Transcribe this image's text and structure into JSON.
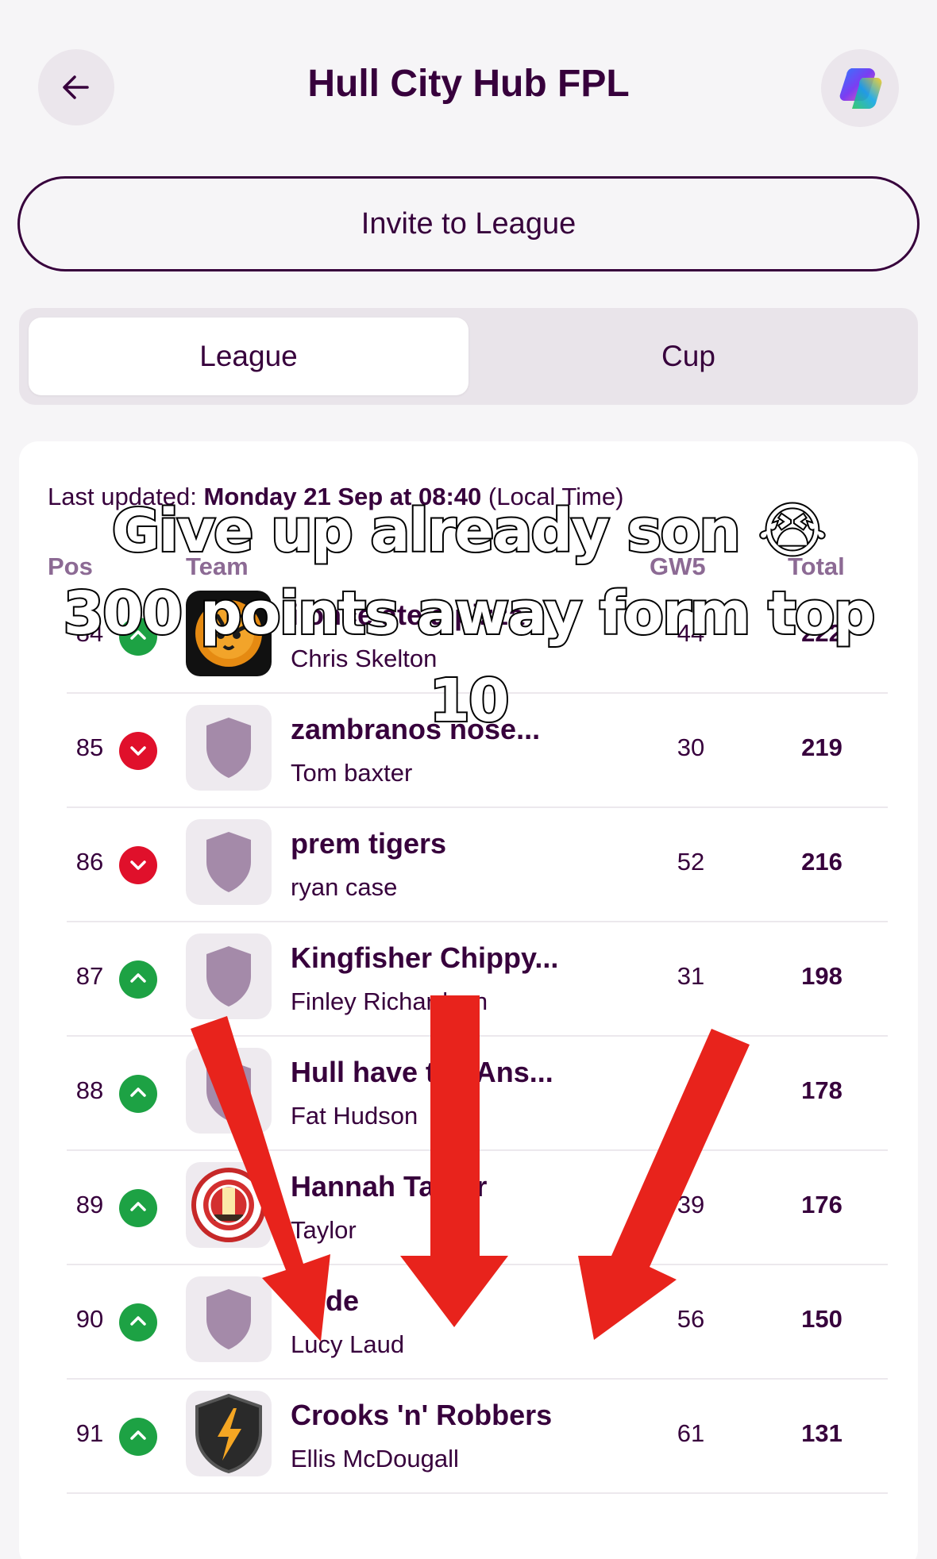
{
  "header": {
    "title": "Hull City Hub FPL",
    "back_icon": "arrow-left-icon",
    "assistant_icon": "copilot-icon"
  },
  "invite": {
    "label": "Invite to League"
  },
  "tabs": [
    {
      "label": "League",
      "active": true
    },
    {
      "label": "Cup",
      "active": false
    }
  ],
  "standings": {
    "last_updated_prefix": "Last updated:",
    "last_updated_value": "Monday 21 Sep at 08:40",
    "last_updated_suffix": "(Local Time)",
    "columns": {
      "pos": "Pos",
      "team": "Team",
      "gw": "GW5",
      "total": "Total"
    },
    "rows": [
      {
        "pos": "84",
        "move": "up",
        "team": "i once ate a pizza",
        "manager": "Chris Skelton",
        "gw": "44",
        "total": "222",
        "crest": "tiger"
      },
      {
        "pos": "85",
        "move": "down",
        "team": "zambranos nose...",
        "manager": "Tom baxter",
        "gw": "30",
        "total": "219",
        "crest": "shield"
      },
      {
        "pos": "86",
        "move": "down",
        "team": "prem tigers",
        "manager": "ryan case",
        "gw": "52",
        "total": "216",
        "crest": "shield"
      },
      {
        "pos": "87",
        "move": "up",
        "team": "Kingfisher Chippy...",
        "manager": "Finley Richardson",
        "gw": "31",
        "total": "198",
        "crest": "shield"
      },
      {
        "pos": "88",
        "move": "up",
        "team": "Hull have the Ans...",
        "manager": "Fat Hudson",
        "gw": "",
        "total": "178",
        "crest": "shield"
      },
      {
        "pos": "89",
        "move": "up",
        "team": "Hannah Taylor",
        "manager": "Taylor",
        "gw": "39",
        "total": "176",
        "crest": "badge"
      },
      {
        "pos": "90",
        "move": "up",
        "team": "dude",
        "manager": "Lucy Laud",
        "gw": "56",
        "total": "150",
        "crest": "shield"
      },
      {
        "pos": "91",
        "move": "up",
        "team": "Crooks 'n' Robbers",
        "manager": "Ellis McDougall",
        "gw": "61",
        "total": "131",
        "crest": "lightning"
      }
    ]
  },
  "overlay": {
    "line1": "Give up already son 😭",
    "line2": "300 points away form top",
    "line3": "10"
  },
  "colors": {
    "brand": "#37003c",
    "up": "#1da244",
    "down": "#e0102b",
    "arrow": "#e8231c"
  }
}
